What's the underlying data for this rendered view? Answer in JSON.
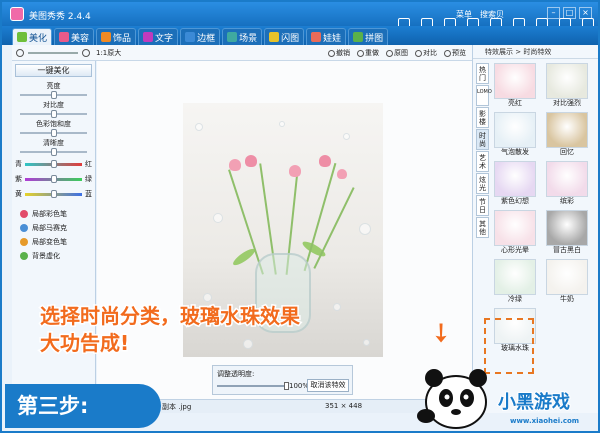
{
  "app": {
    "title": "美图秀秀 2.4.4",
    "menu_label": "菜单",
    "search_label": "搜索贝"
  },
  "tabs": [
    {
      "label": "美化",
      "color": "#6fbf3a"
    },
    {
      "label": "美容",
      "color": "#e85a8a"
    },
    {
      "label": "饰品",
      "color": "#f08a24"
    },
    {
      "label": "文字",
      "color": "#c03bbd"
    },
    {
      "label": "边框",
      "color": "#3b8ad6"
    },
    {
      "label": "场景",
      "color": "#3fa9a0"
    },
    {
      "label": "闪图",
      "color": "#e6c32a"
    },
    {
      "label": "娃娃",
      "color": "#e86b5a"
    },
    {
      "label": "拼图",
      "color": "#5ab14b"
    }
  ],
  "toolbar": [
    "打开",
    "保存",
    "相册",
    "截图",
    "裁剪",
    "尺寸",
    "涂鸦",
    "拍照",
    "修图"
  ],
  "subbar": {
    "zoom_label": "1:1原大",
    "tools": [
      "撤销",
      "重做",
      "原图",
      "对比",
      "预览"
    ]
  },
  "left_panel": {
    "one_click": "一键美化",
    "sliders": [
      "亮度",
      "对比度",
      "色彩饱和度",
      "清晰度"
    ],
    "colors": [
      {
        "left": "青",
        "right": "红",
        "grad": "linear-gradient(90deg,#2ec6c6,#e23b3b)"
      },
      {
        "left": "紫",
        "right": "绿",
        "grad": "linear-gradient(90deg,#b03bd6,#3bcf5a)"
      },
      {
        "left": "黄",
        "right": "蓝",
        "grad": "linear-gradient(90deg,#e6d22a,#3b6fe6)"
      }
    ],
    "tools": [
      {
        "label": "局部彩色笔",
        "color": "#e24b6a"
      },
      {
        "label": "局部马赛克",
        "color": "#4a8fd6"
      },
      {
        "label": "局部变色笔",
        "color": "#e69a2a"
      },
      {
        "label": "背景虚化",
        "color": "#5ab14b"
      }
    ]
  },
  "canvas": {
    "opacity_label": "调整透明度:",
    "opacity_value": "100%",
    "cancel_label": "取消该特效"
  },
  "status": {
    "file_label": "副本 .jpg",
    "dimensions": "351 × 448"
  },
  "right_panel": {
    "header": "特效展示 > 时尚特效",
    "vertical_tabs": [
      "热门",
      "LOMO",
      "影楼",
      "时尚",
      "艺术",
      "炫光",
      "节日",
      "其他"
    ],
    "active_tab": "时尚",
    "effects": [
      {
        "name": "亮红",
        "color": "#f7dbe2"
      },
      {
        "name": "对比强烈",
        "color": "#e7e9df"
      },
      {
        "name": "气泡散发",
        "color": "#e6f0f6"
      },
      {
        "name": "回忆",
        "color": "#d9c5a0"
      },
      {
        "name": "紫色幻想",
        "color": "#e6d8f2"
      },
      {
        "name": "缤彩",
        "color": "#f2dbea"
      },
      {
        "name": "心形光晕",
        "color": "#f7e1e8"
      },
      {
        "name": "冒古黑白",
        "color": "#a8a8a8"
      },
      {
        "name": "冷绿",
        "color": "#e3f0e6"
      },
      {
        "name": "牛奶",
        "color": "#f4f2ee"
      },
      {
        "name": "玻璃水珠",
        "color": "#eef3f4"
      }
    ]
  },
  "caption": {
    "line1": "选择时尚分类，玻璃水珠效果",
    "line2": "大功告成!"
  },
  "step_badge": "第三步:",
  "brand": {
    "name": "小黑游戏",
    "url": "www.xiaohei.com"
  }
}
